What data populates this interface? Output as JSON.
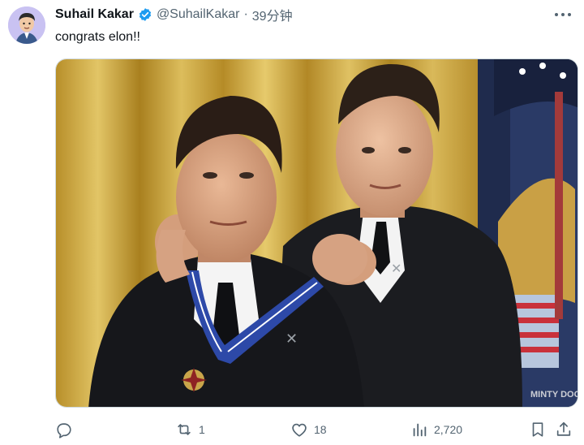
{
  "tweet": {
    "author_name": "Suhail Kakar",
    "handle": "@SuhailKakar",
    "separator": "·",
    "time": "39分钟",
    "text": "congrats elon!!",
    "media_watermark": "MINTY DOGE"
  },
  "actions": {
    "reply_count": "",
    "retweet_count": "1",
    "like_count": "18",
    "views_count": "2,720"
  },
  "icons": {
    "verified": "verified-badge-icon",
    "more": "more-options-icon",
    "reply": "reply-icon",
    "retweet": "retweet-icon",
    "like": "like-icon",
    "views": "views-icon",
    "bookmark": "bookmark-icon"
  },
  "colors": {
    "verified_blue": "#1d9bf0",
    "muted_text": "#536471",
    "avatar_bg": "#c9c2f2"
  }
}
